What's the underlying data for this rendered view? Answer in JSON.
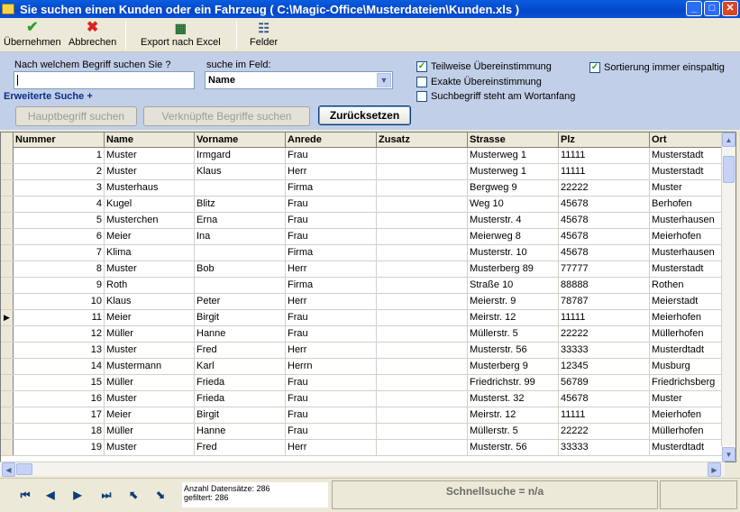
{
  "window": {
    "title": "Sie suchen einen Kunden oder ein Fahrzeug ( C:\\Magic-Office\\Musterdateien\\Kunden.xls )",
    "btn_min": "_",
    "btn_max": "□",
    "btn_close": "✕"
  },
  "toolbar": {
    "uebernehmen": "Übernehmen",
    "abbrechen": "Abbrechen",
    "export": "Export nach Excel",
    "felder": "Felder"
  },
  "search": {
    "term_label": "Nach welchem Begriff suchen Sie ?",
    "term_value": "",
    "field_label": "suche im Feld:",
    "field_value": "Name",
    "advanced": "Erweiterte Suche +",
    "opt_partial": "Teilweise Übereinstimmung",
    "opt_exact": "Exakte Übereinstimmung",
    "opt_start": "Suchbegriff steht am Wortanfang",
    "opt_sort": "Sortierung immer einspaltig",
    "btn_main": "Hauptbegriff suchen",
    "btn_linked": "Verknüpfte Begriffe suchen",
    "btn_reset": "Zurücksetzen"
  },
  "grid": {
    "columns": [
      "Nummer",
      "Name",
      "Vorname",
      "Anrede",
      "Zusatz",
      "Strasse",
      "Plz",
      "Ort"
    ],
    "rows": [
      [
        "1",
        "Muster",
        "Irmgard",
        "Frau",
        "",
        "Musterweg 1",
        "11111",
        "Musterstadt"
      ],
      [
        "2",
        "Muster",
        "Klaus",
        "Herr",
        "",
        "Musterweg 1",
        "11111",
        "Musterstadt"
      ],
      [
        "3",
        "Musterhaus",
        "",
        "Firma",
        "",
        "Bergweg 9",
        "22222",
        "Muster"
      ],
      [
        "4",
        "Kugel",
        "Blitz",
        "Frau",
        "",
        "Weg 10",
        "45678",
        "Berhofen"
      ],
      [
        "5",
        "Musterchen",
        "Erna",
        "Frau",
        "",
        "Musterstr. 4",
        "45678",
        "Musterhausen"
      ],
      [
        "6",
        "Meier",
        "Ina",
        "Frau",
        "",
        "Meierweg 8",
        "45678",
        "Meierhofen"
      ],
      [
        "7",
        "Klima",
        "",
        "Firma",
        "",
        "Musterstr. 10",
        "45678",
        "Musterhausen"
      ],
      [
        "8",
        "Muster",
        "Bob",
        "Herr",
        "",
        "Musterberg 89",
        "77777",
        "Musterstadt"
      ],
      [
        "9",
        "Roth",
        "",
        "Firma",
        "",
        "Straße 10",
        "88888",
        "Rothen"
      ],
      [
        "10",
        "Klaus",
        "Peter",
        "Herr",
        "",
        "Meierstr. 9",
        "78787",
        "Meierstadt"
      ],
      [
        "11",
        "Meier",
        "Birgit",
        "Frau",
        "",
        "Meirstr. 12",
        "11111",
        "Meierhofen"
      ],
      [
        "12",
        "Müller",
        "Hanne",
        "Frau",
        "",
        "Müllerstr. 5",
        "22222",
        "Müllerhofen"
      ],
      [
        "13",
        "Muster",
        "Fred",
        "Herr",
        "",
        "Musterstr. 56",
        "33333",
        "Musterdtadt"
      ],
      [
        "14",
        "Mustermann",
        "Karl",
        "Herrn",
        "",
        "Musterberg 9",
        "12345",
        "Musburg"
      ],
      [
        "15",
        "Müller",
        "Frieda",
        "Frau",
        "",
        "Friedrichstr. 99",
        "56789",
        "Friedrichsberg"
      ],
      [
        "16",
        "Muster",
        "Frieda",
        "Frau",
        "",
        "Musterst. 32",
        "45678",
        "Muster"
      ],
      [
        "17",
        "Meier",
        "Birgit",
        "Frau",
        "",
        "Meirstr. 12",
        "11111",
        "Meierhofen"
      ],
      [
        "18",
        "Müller",
        "Hanne",
        "Frau",
        "",
        "Müllerstr. 5",
        "22222",
        "Müllerhofen"
      ],
      [
        "19",
        "Muster",
        "Fred",
        "Herr",
        "",
        "Musterstr. 56",
        "33333",
        "Musterdtadt"
      ]
    ],
    "current_row": 10
  },
  "status": {
    "count": "Anzahl Datensätze: 286",
    "filtered": "gefiltert: 286",
    "quick": "Schnellsuche = n/a"
  }
}
